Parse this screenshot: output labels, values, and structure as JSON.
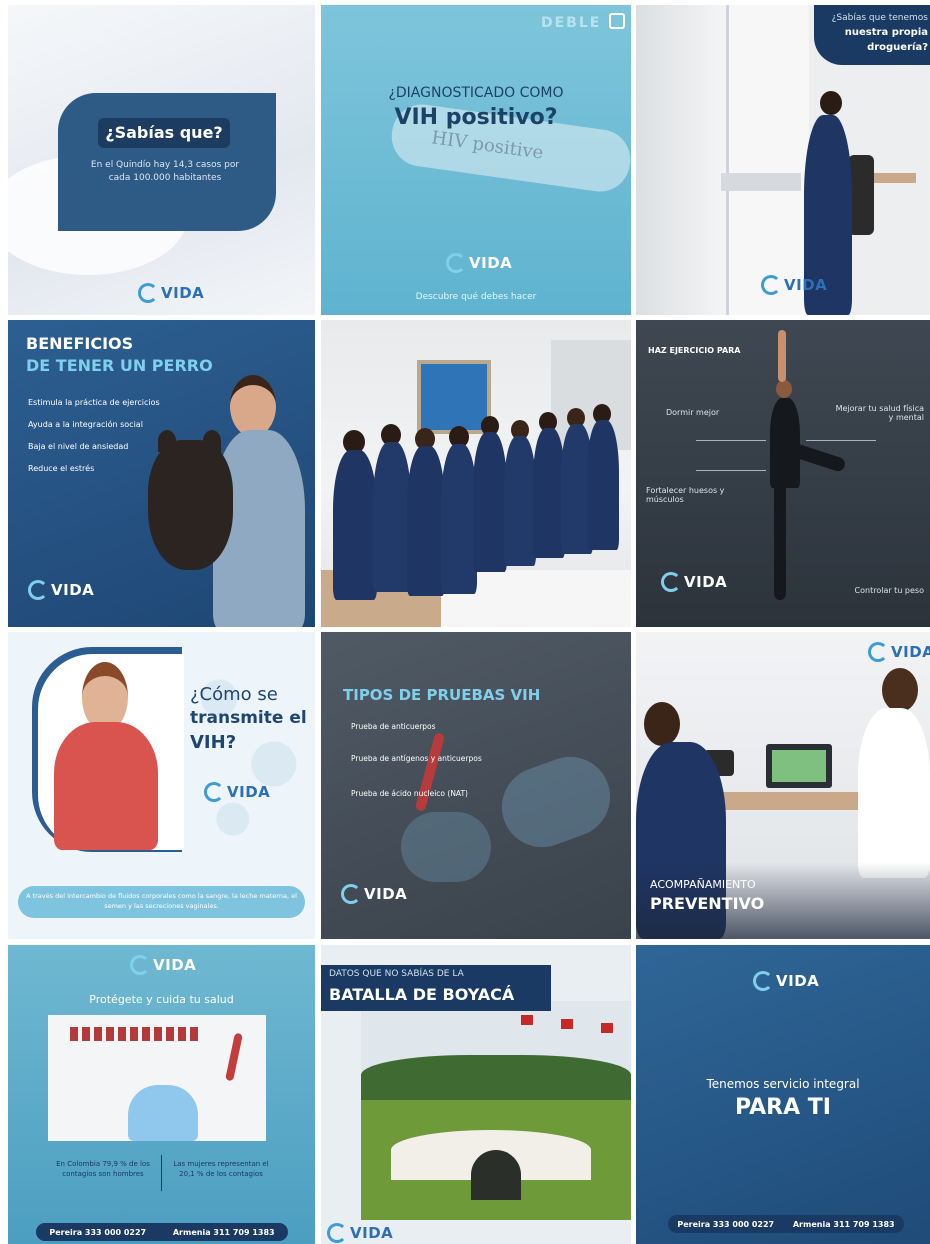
{
  "brand": {
    "logo_text": "VIDA"
  },
  "tiles": {
    "t1": {
      "title": "¿Sabías que?",
      "body": "En el Quindío hay 14,3 casos por cada 100.000 habitantes"
    },
    "t2": {
      "title_top": "¿DIAGNOSTICADO COMO",
      "title_main": "VIH positivo?",
      "tube_label": "HIV positive",
      "footer": "Descubre qué debes hacer",
      "watermark": "DEBLE"
    },
    "t3": {
      "corner_line1": "¿Sabías que tenemos",
      "corner_line2": "nuestra propia",
      "corner_line3": "droguería?"
    },
    "t4": {
      "title_line1": "BENEFICIOS",
      "title_line2": "DE TENER UN PERRO",
      "bullets": [
        "Estimula la práctica de ejercicios",
        "Ayuda a la integración social",
        "Baja el nivel de ansiedad",
        "Reduce el estrés"
      ]
    },
    "t5": {},
    "t6": {
      "title": "HAZ EJERCICIO PARA",
      "items": [
        "Dormir mejor",
        "Mejorar tu salud física y mental",
        "Fortalecer huesos y músculos",
        "Controlar tu peso"
      ]
    },
    "t7": {
      "title_line1": "¿Cómo se",
      "title_line2": "transmite el",
      "title_line3": "VIH?",
      "footer": "A través del intercambio de fluidos corporales como la sangre, la leche materna, el semen y las secreciones vaginales."
    },
    "t8": {
      "title": "TIPOS DE PRUEBAS VIH",
      "items": [
        "Prueba de anticuerpos",
        "Prueba de antígenos y anticuerpos",
        "Prueba de ácido nucleico (NAT)"
      ]
    },
    "t9": {
      "title_line1": "ACOMPAÑAMIENTO",
      "title_line2": "PREVENTIVO"
    },
    "t10": {
      "title": "Protégete y cuida tu salud",
      "left_text": "En Colombia 79,9 % de los contagios son hombres",
      "right_text": "Las mujeres representan el 20,1 % de los contagios",
      "contact_1": "Pereira 333 000 0227",
      "contact_2": "Armenia 311 709 1383"
    },
    "t11": {
      "title_line1": "DATOS QUE NO SABÍAS DE LA",
      "title_line2": "BATALLA DE BOYACÁ"
    },
    "t12": {
      "title_line1": "Tenemos servicio integral",
      "title_line2": "PARA TI",
      "contact_1": "Pereira 333 000 0227",
      "contact_2": "Armenia 311 709 1383"
    }
  }
}
